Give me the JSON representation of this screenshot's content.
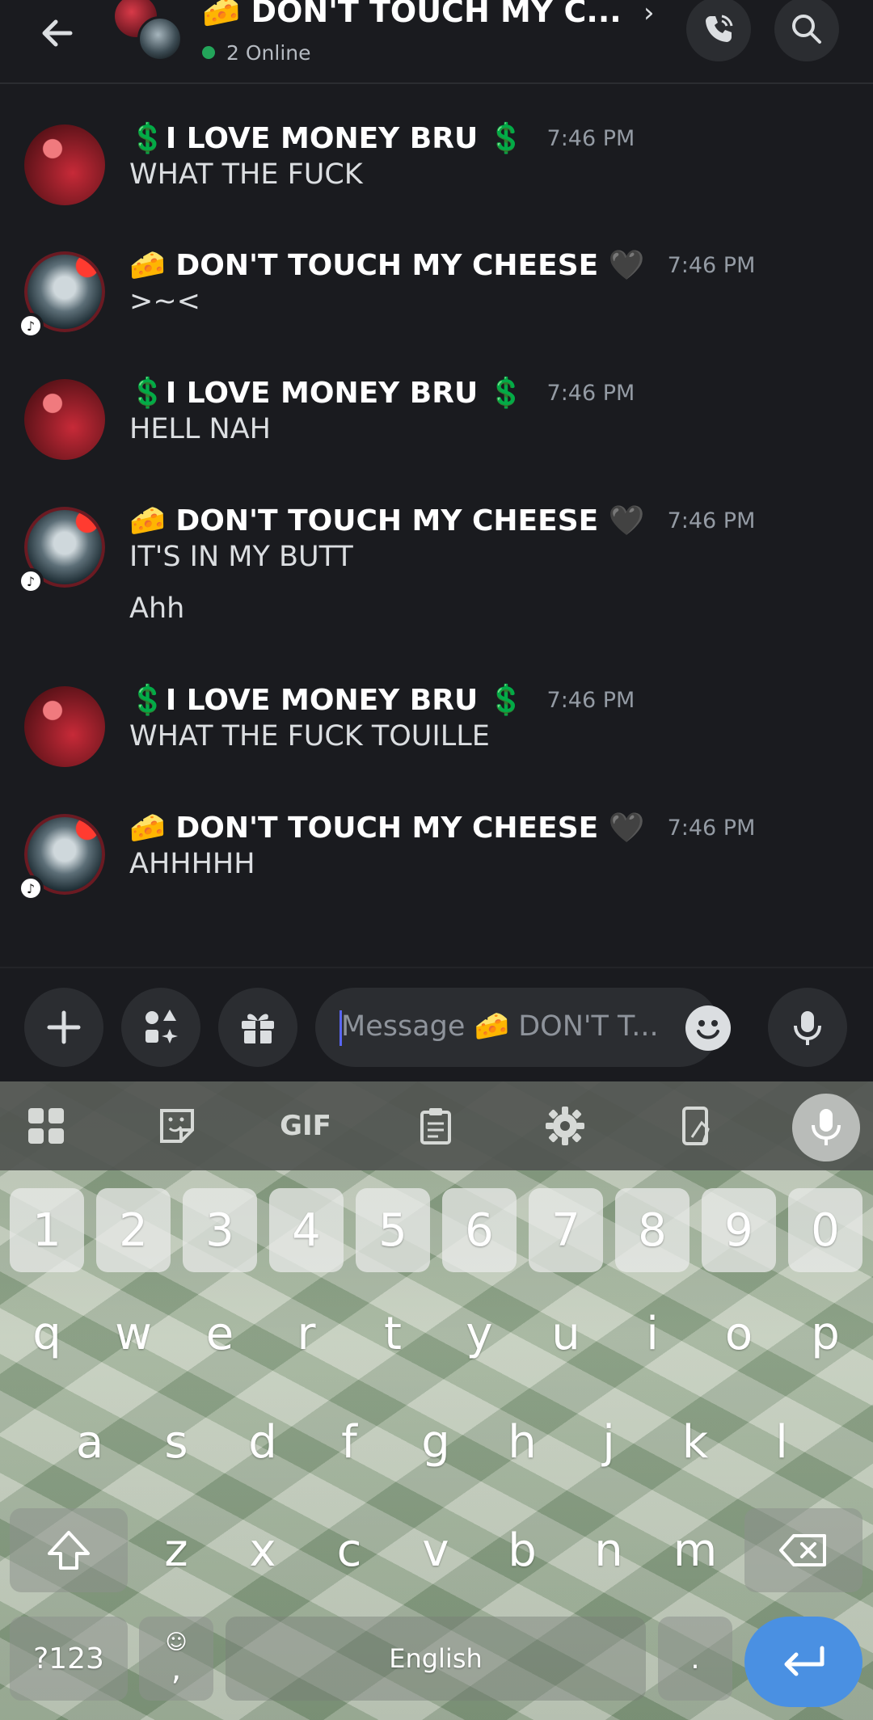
{
  "header": {
    "title": "🧀 DON'T TOUCH MY C...",
    "online": "2 Online"
  },
  "messages": [
    {
      "author": "💲I LOVE MONEY BRU 💲",
      "time": "7:46 PM",
      "lines": [
        "WHAT THE FUCK"
      ],
      "avatar": "red"
    },
    {
      "author": "🧀 DON'T TOUCH MY CHEESE 🖤",
      "time": "7:46 PM",
      "lines": [
        ">~<"
      ],
      "avatar": "grey"
    },
    {
      "author": "💲I LOVE MONEY BRU 💲",
      "time": "7:46 PM",
      "lines": [
        "HELL NAH"
      ],
      "avatar": "red"
    },
    {
      "author": "🧀 DON'T TOUCH MY CHEESE 🖤",
      "time": "7:46 PM",
      "lines": [
        "IT'S IN MY BUTT",
        "Ahh"
      ],
      "avatar": "grey"
    },
    {
      "author": "💲I LOVE MONEY BRU 💲",
      "time": "7:46 PM",
      "lines": [
        "WHAT THE FUCK TOUILLE"
      ],
      "avatar": "red"
    },
    {
      "author": "🧀 DON'T TOUCH MY CHEESE 🖤",
      "time": "7:46 PM",
      "lines": [
        "AHHHHH"
      ],
      "avatar": "grey"
    }
  ],
  "composer": {
    "placeholder": "Message 🧀 DON'T T..."
  },
  "keyboard": {
    "toolbar_gif": "GIF",
    "numbers": [
      "1",
      "2",
      "3",
      "4",
      "5",
      "6",
      "7",
      "8",
      "9",
      "0"
    ],
    "row1": [
      "q",
      "w",
      "e",
      "r",
      "t",
      "y",
      "u",
      "i",
      "o",
      "p"
    ],
    "row2": [
      "a",
      "s",
      "d",
      "f",
      "g",
      "h",
      "j",
      "k",
      "l"
    ],
    "row3": [
      "z",
      "x",
      "c",
      "v",
      "b",
      "n",
      "m"
    ],
    "symbols_key": "?123",
    "comma_key": ",",
    "space_label": "English",
    "period_key": "."
  },
  "colors": {
    "background": "#1a1b1f",
    "online": "#23a55a",
    "accent": "#5865f2",
    "enter_key": "#4a90e2"
  }
}
